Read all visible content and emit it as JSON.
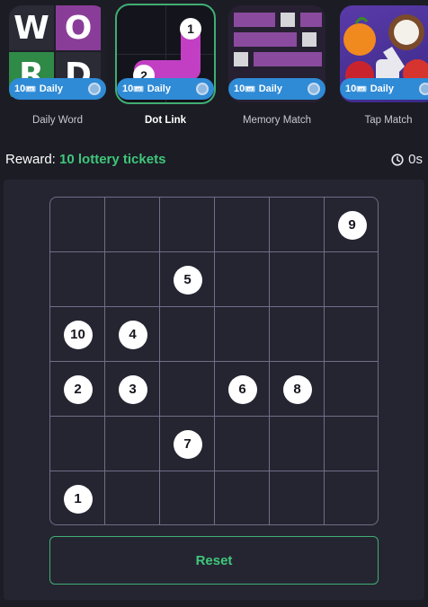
{
  "games": [
    {
      "label": "Daily Word",
      "badge": "10",
      "badge_suffix": "Daily",
      "ticket_icon": "ticket-icon",
      "active": false
    },
    {
      "label": "Dot Link",
      "badge": "10",
      "badge_suffix": "Daily",
      "ticket_icon": "ticket-icon",
      "active": true
    },
    {
      "label": "Memory Match",
      "badge": "10",
      "badge_suffix": "Daily",
      "ticket_icon": "ticket-icon",
      "active": false
    },
    {
      "label": "Tap Match",
      "badge": "10",
      "badge_suffix": "Daily",
      "ticket_icon": "ticket-icon",
      "active": false
    }
  ],
  "thumb_word": {
    "letters": [
      "W",
      "O",
      "R",
      "D"
    ]
  },
  "thumb_dot": {
    "n1": "1",
    "n2": "2"
  },
  "status": {
    "reward_label": "Reward:",
    "reward_value": "10 lottery tickets",
    "timer_icon": "clock-icon",
    "timer": "0s"
  },
  "board": {
    "rows": 6,
    "cols": 6,
    "dots": [
      {
        "n": "9",
        "row": 0,
        "col": 5
      },
      {
        "n": "5",
        "row": 1,
        "col": 2
      },
      {
        "n": "10",
        "row": 2,
        "col": 0
      },
      {
        "n": "4",
        "row": 2,
        "col": 1
      },
      {
        "n": "2",
        "row": 3,
        "col": 0
      },
      {
        "n": "3",
        "row": 3,
        "col": 1
      },
      {
        "n": "6",
        "row": 3,
        "col": 3
      },
      {
        "n": "8",
        "row": 3,
        "col": 4
      },
      {
        "n": "7",
        "row": 4,
        "col": 2
      },
      {
        "n": "1",
        "row": 5,
        "col": 0
      }
    ]
  },
  "reset_label": "Reset",
  "colors": {
    "accent_green": "#3fc77a",
    "badge_blue": "#2f8bd6",
    "background": "#1c1c25",
    "panel": "#252532"
  }
}
